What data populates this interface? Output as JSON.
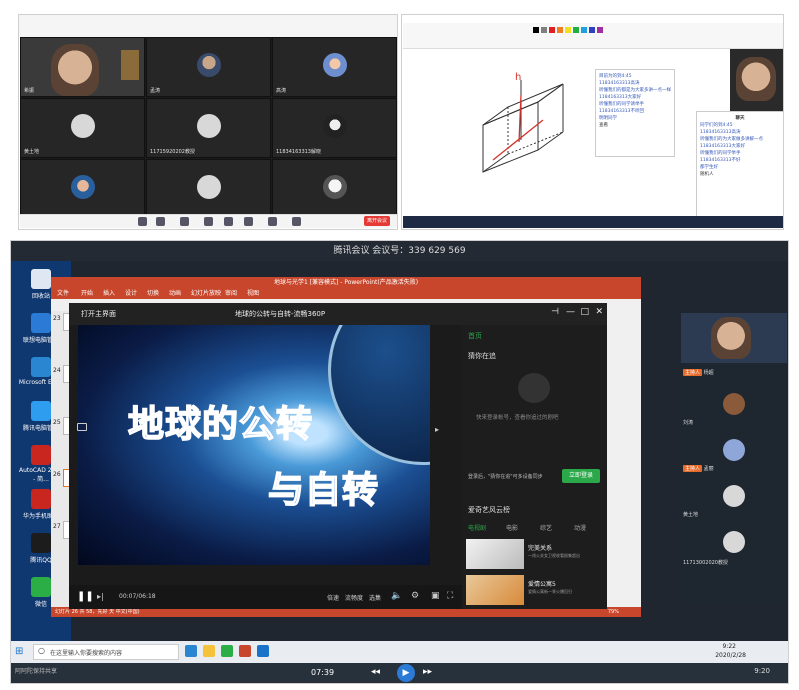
{
  "gallery": {
    "participants": [
      {
        "name": "希振"
      },
      {
        "name": "孟涛"
      },
      {
        "name": "高涛"
      },
      {
        "name": "黄土地"
      },
      {
        "name": "11715920202教授"
      },
      {
        "name": "11834163313解晓"
      },
      {
        "name": ""
      },
      {
        "name": ""
      },
      {
        "name": ""
      }
    ],
    "leave_label": "离开会议"
  },
  "paint": {
    "chat_lines": [
      "目前为的到4:45",
      "11834163313高涛",
      "听懂我们的都是为大家多讲一点一样",
      "1184163313大家好",
      "听懂我们的同学请举手",
      "11834163313不听回",
      "明明同学",
      "查看"
    ],
    "chat2_title": "聊天",
    "chat2_lines": [
      "同学们的到4:45",
      "11834163313高涛",
      "听懂我们的为大家做多讲解一点",
      "11834163313大家好",
      "听懂我们的同学举手",
      "11834163313不好",
      "都学生好",
      "随机人"
    ],
    "drawing_label": "h"
  },
  "main": {
    "window_title": "腾讯会议 会议号：339 629 569",
    "ppt_title": "地球与光学1 [兼容模式] - PowerPoint(产品激活失败)",
    "ppt_tabs": [
      "文件",
      "开始",
      "插入",
      "设计",
      "切换",
      "动画",
      "幻灯片放映",
      "审阅",
      "视图"
    ],
    "ppt_meeting_id": "会议号 339 629 569",
    "desktop_icons": [
      {
        "label": "回收站",
        "color": "#dfe8f2"
      },
      {
        "label": "联想电脑管家",
        "color": "#2b7bd6"
      },
      {
        "label": "Microsoft Edge",
        "color": "#2a86d1"
      },
      {
        "label": "腾讯电脑管家",
        "color": "#2e9df0"
      },
      {
        "label": "AutoCAD 2016 - 简...",
        "color": "#c8261e"
      },
      {
        "label": "华为手机助手",
        "color": "#c8261e"
      },
      {
        "label": "腾讯QQ",
        "color": "#1c1c1c"
      },
      {
        "label": "微信",
        "color": "#2aae45"
      }
    ],
    "slide_numbers": [
      "23",
      "24",
      "25",
      "26",
      "27"
    ],
    "player": {
      "open_label": "打开主界面",
      "video_title": "地球的公转与自转-流畅360P",
      "line1": "地球的公转",
      "line2": "与自转",
      "time": "00:07/06:18",
      "speed": "倍速",
      "quality": "流畅度",
      "select": "选集",
      "side_tab": "首页",
      "guess": "猜你在追",
      "login_hint": "快来登录帐号，查看你追过的剧吧",
      "login_text": "登录后，\"猜你在追\"可多设备同步",
      "login_button": "立即登录",
      "cloud_list": "爱奇艺风云榜",
      "categories": [
        "电视剧",
        "电影",
        "综艺",
        "动漫"
      ],
      "recs": [
        {
          "title": "完美关系",
          "sub": "一线公关女卫视收看剧集超出"
        },
        {
          "title": "爱情公寓5",
          "sub": "爱情公寓新一季火爆回归"
        }
      ]
    },
    "ppt_status": "幻灯片 26 共 58，先好 天 中文(中国)",
    "ppt_zoom": "79%",
    "search_placeholder": "在这里输入你要搜索的内容",
    "taskbar_time": "9:22",
    "taskbar_date": "2020/2/28",
    "bottom_time": "07:39",
    "bottom_clock": "9:20",
    "right_panel": [
      {
        "name": "杨超",
        "host": "主持人"
      },
      {
        "name": "刘涛",
        "host": ""
      },
      {
        "name": "孟丽",
        "host": "主持人"
      },
      {
        "name": "黄土地",
        "host": ""
      },
      {
        "name": "11713002020教授",
        "host": ""
      }
    ],
    "bottom_left": "阿阿陀保持共享"
  }
}
